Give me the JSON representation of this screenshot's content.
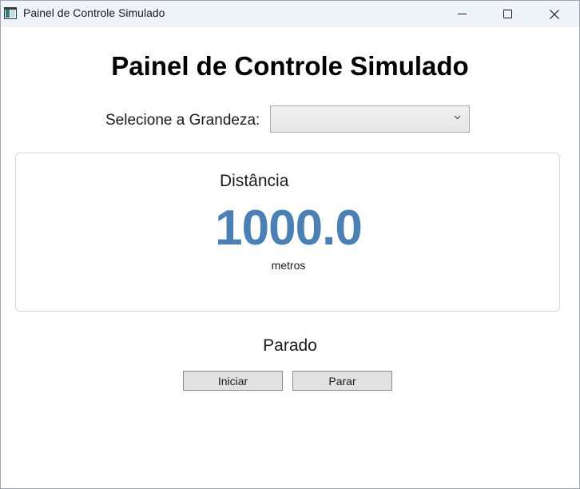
{
  "window": {
    "title": "Painel de Controle Simulado",
    "app_icon": "window-app-icon",
    "controls": {
      "minimize_icon": "minimize-icon",
      "maximize_icon": "maximize-icon",
      "close_icon": "close-icon"
    }
  },
  "main": {
    "heading": "Painel de Controle Simulado",
    "selector": {
      "label": "Selecione a Grandeza:",
      "selected_value": "",
      "chevron_icon": "chevron-down-icon"
    },
    "display": {
      "quantity_name": "Distância",
      "value": "1000.0",
      "unit": "metros",
      "value_color": "#4a80b4"
    },
    "status": "Parado",
    "buttons": {
      "start_label": "Iniciar",
      "stop_label": "Parar"
    }
  }
}
